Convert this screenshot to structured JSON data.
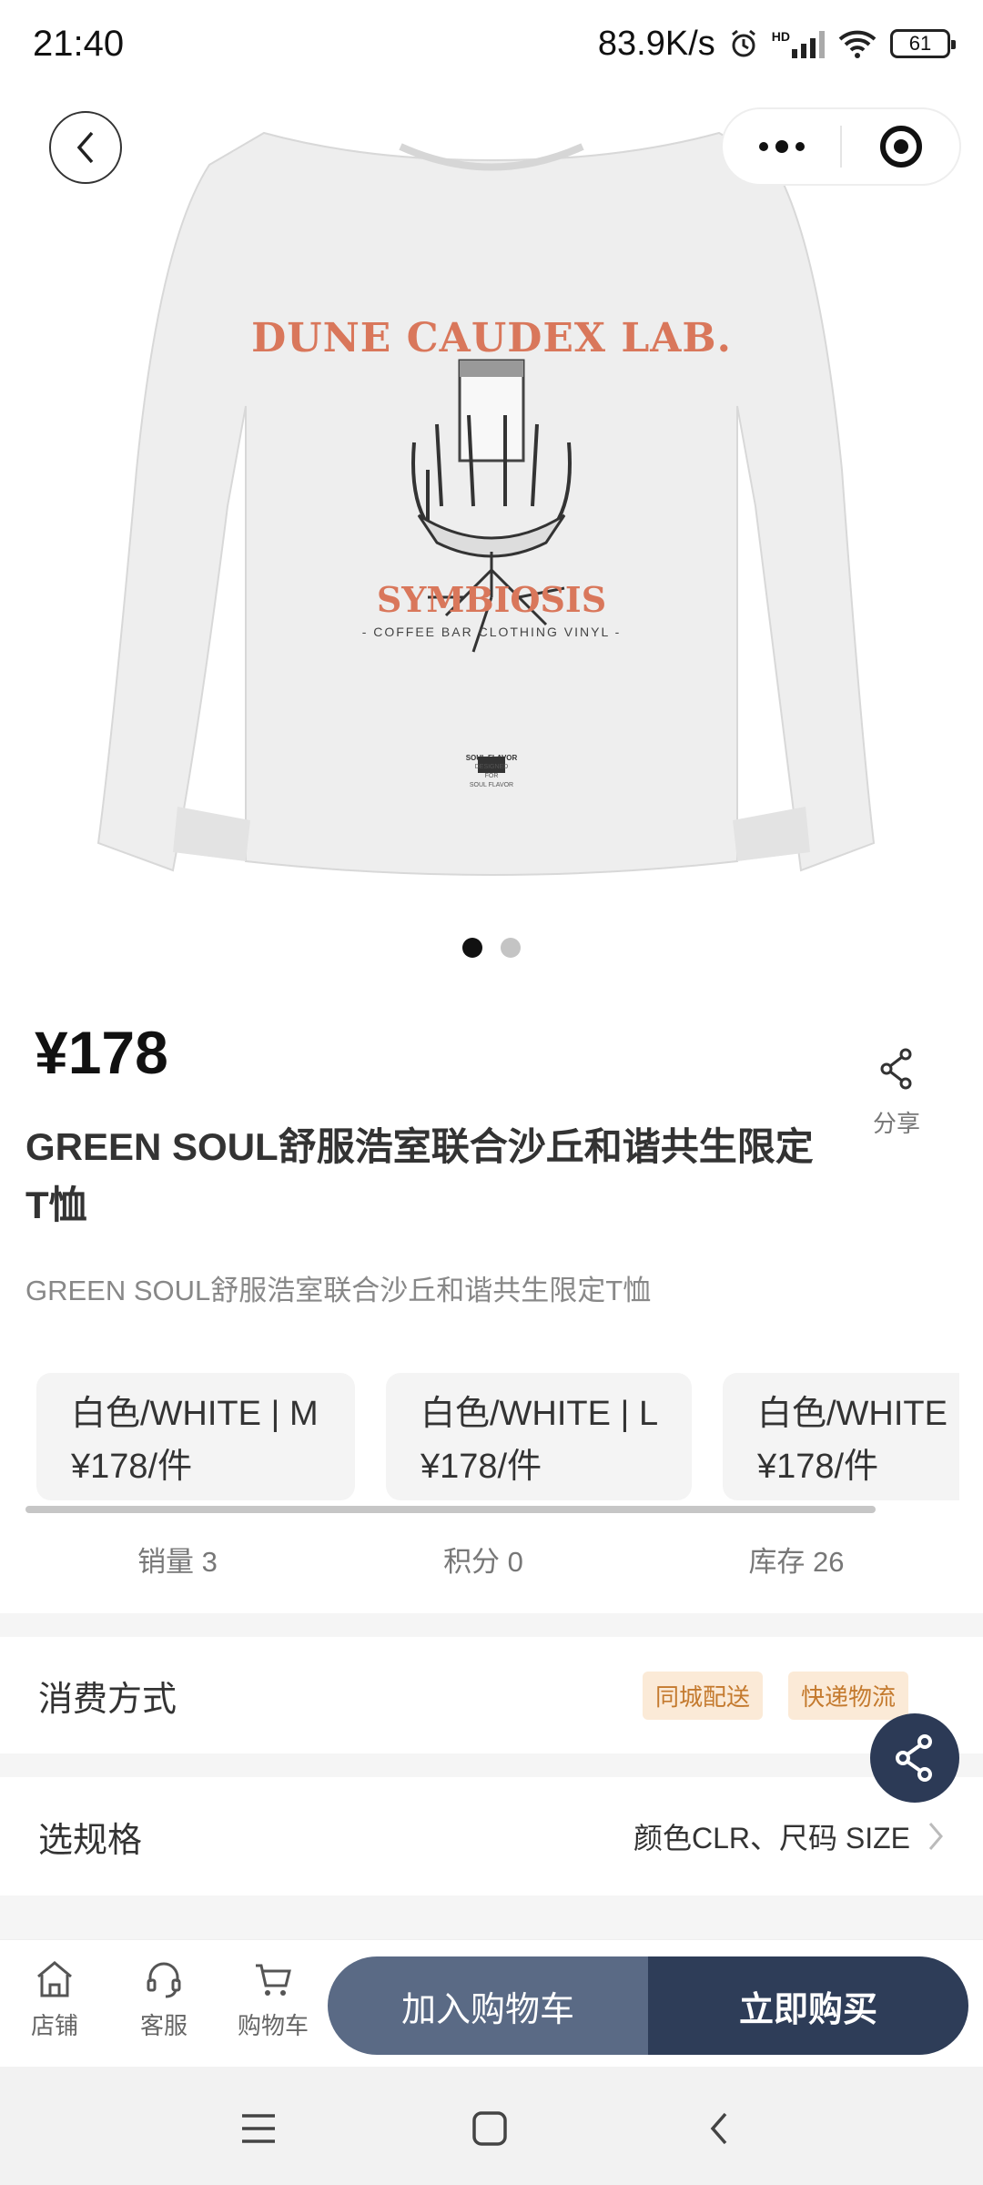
{
  "status_bar": {
    "time": "21:40",
    "network_speed": "83.9K/s",
    "battery": "61",
    "hd_label": "HD"
  },
  "product": {
    "price": "¥178",
    "title": "GREEN SOUL舒服浩室联合沙丘和谐共生限定T恤",
    "subtitle": "GREEN SOUL舒服浩室联合沙丘和谐共生限定T恤",
    "image_count": 2,
    "active_image": 1,
    "shirt_text": {
      "brand": "DUNE CAUDEX LAB.",
      "tagline": "SYMBIOSIS",
      "sub": "- COFFEE  BAR  CLOTHING  VINYL -",
      "small_logo_1": "SOUL FLAVOR",
      "small_logo_2": "DESIGNED",
      "small_logo_3": "FOR",
      "small_logo_4": "SOUL FLAVOR"
    }
  },
  "share_label": "分享",
  "skus": [
    {
      "name": "白色/WHITE | M",
      "price": "¥178/件"
    },
    {
      "name": "白色/WHITE | L",
      "price": "¥178/件"
    },
    {
      "name": "白色/WHITE",
      "price": "¥178/件"
    }
  ],
  "stats": {
    "sales": "销量 3",
    "points": "积分 0",
    "stock": "库存 26"
  },
  "consumption": {
    "label": "消费方式",
    "tags": [
      "同城配送",
      "快递物流"
    ]
  },
  "spec": {
    "label": "选规格",
    "value": "颜色CLR、尺码 SIZE"
  },
  "bottom_nav": {
    "store": "店铺",
    "service": "客服",
    "cart": "购物车"
  },
  "actions": {
    "add_to_cart": "加入购物车",
    "buy_now": "立即购买"
  },
  "colors": {
    "primary_dark": "#2e3d58",
    "primary_light": "#5a6a85",
    "shirt_print": "#d9775b",
    "tag_bg": "#fbead7"
  }
}
